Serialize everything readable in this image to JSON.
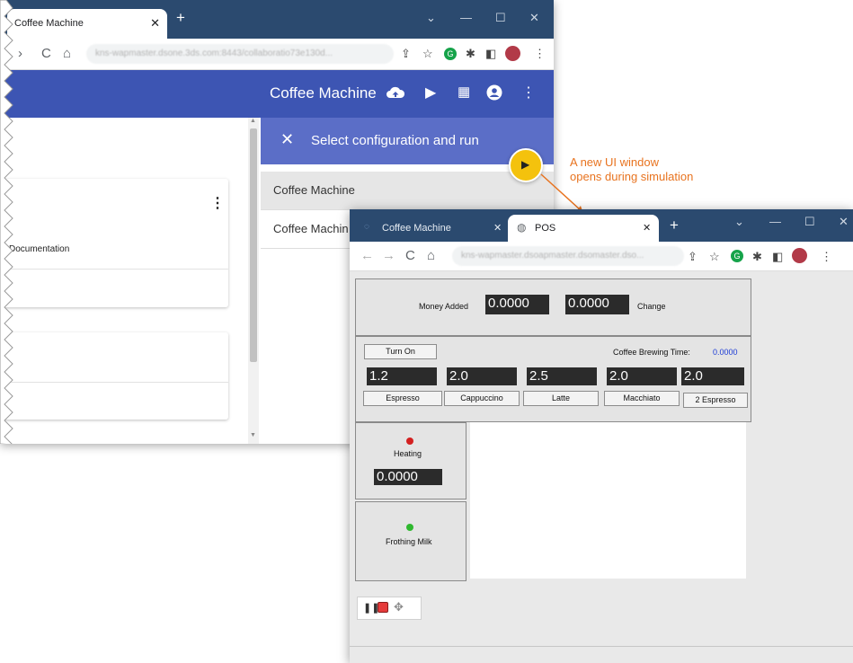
{
  "back_window": {
    "tab_title": "Coffee Machine",
    "tab_close": "✕",
    "new_tab": "+",
    "url": "kns-wapmaster.dsone.3ds.com:8443/collaboratio73e130d...",
    "app_title": "Coffee Machine",
    "card_documentation": "Documentation",
    "panel_title": "Select configuration and run",
    "panel_close": "✕",
    "configurations": [
      "Coffee Machine",
      "Coffee Machin"
    ]
  },
  "callout": {
    "line1": "A new UI window",
    "line2": "opens during simulation",
    "color": "#e8731f"
  },
  "front_window": {
    "tab1_title": "Coffee Machine",
    "tab2_title": "POS",
    "tab_close": "✕",
    "new_tab": "+",
    "url": "kns-wapmaster.dsoapmaster.dsomaster.dso...",
    "pos": {
      "money_added_label": "Money Added",
      "money_added_value": "0.0000",
      "change_value": "0.0000",
      "change_label": "Change",
      "turn_on_label": "Turn On",
      "brewing_time_label": "Coffee Brewing Time:",
      "brewing_time_value": "0.0000",
      "drinks": [
        {
          "value": "1.2",
          "label": "Espresso"
        },
        {
          "value": "2.0",
          "label": "Cappuccino"
        },
        {
          "value": "2.5",
          "label": "Latte"
        },
        {
          "value": "2.0",
          "label": "Macchiato"
        },
        {
          "value": "2.0",
          "label": "2 Espresso"
        }
      ],
      "heating_label": "Heating",
      "heating_value": "0.0000",
      "heating_led_color": "#d32020",
      "frothing_label": "Frothing Milk",
      "frothing_led_color": "#2fb82f"
    }
  },
  "colors": {
    "tabbar": "#2b4a6f",
    "appbar": "#3d55b3",
    "panelhead": "#5b6ec7",
    "run_button": "#f4c20d"
  }
}
